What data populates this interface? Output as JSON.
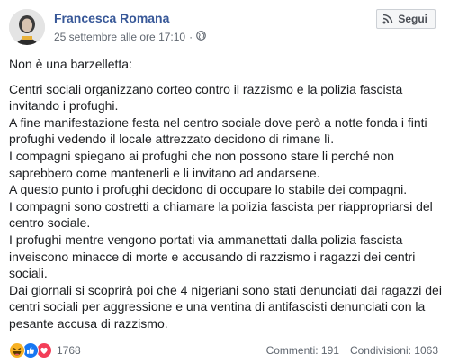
{
  "post": {
    "author": "Francesca Romana",
    "timestamp": "25 settembre alle ore 17:10",
    "separator": "·",
    "privacy_icon": "globe-icon",
    "follow_label": "Segui",
    "title": "Non è una barzelletta:",
    "paragraphs": [
      "Centri sociali organizzano corteo contro il razzismo e la polizia fascista invitando i profughi.",
      "A fine manifestazione festa nel centro sociale dove però a notte fonda i finti profughi vedendo il locale attrezzato decidono di rimane lì.",
      "I compagni spiegano ai profughi che non possono stare li perché non saprebbero come mantenerli e li invitano ad andarsene.",
      "A questo punto i profughi decidono di occupare lo stabile dei compagni.",
      "I compagni sono costretti a chiamare la polizia fascista per riappropriarsi del centro sociale.",
      "I profughi mentre vengono portati via ammanettati dalla polizia fascista inveiscono minacce di morte e accusando di razzismo i ragazzi dei centri sociali.",
      "Dai giornali si scoprirà poi che 4 nigeriani sono stati denunciati dai ragazzi dei centri sociali per aggressione e una ventina di antifascisti denunciati con la pesante accusa di razzismo."
    ],
    "reactions": {
      "icons": [
        "haha-icon",
        "like-icon",
        "love-icon"
      ],
      "count": "1768"
    },
    "comments": "Commenti: 191",
    "shares": "Condivisioni: 1063",
    "colors": {
      "author": "#385898",
      "meta": "#606770",
      "like": "#1877f2",
      "love": "#f33e58",
      "haha": "#f7b125"
    }
  }
}
